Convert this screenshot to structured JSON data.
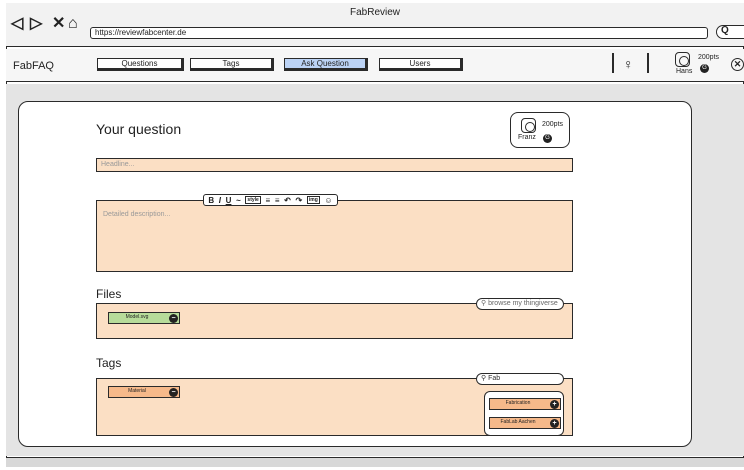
{
  "window": {
    "title": "FabReview",
    "url": "https://reviewfabcenter.de"
  },
  "browser_icons": {
    "back": "arrow-left-icon",
    "forward": "arrow-right-icon",
    "stop": "close-icon",
    "home": "home-icon",
    "search": "search-icon"
  },
  "app": {
    "brand": "FabFAQ",
    "tabs": [
      {
        "label": "Questions",
        "active": false
      },
      {
        "label": "Tags",
        "active": false
      },
      {
        "label": "Ask Question",
        "active": true
      },
      {
        "label": "Users",
        "active": false
      }
    ],
    "user": {
      "name": "Hans",
      "points": "200pts",
      "badge": "G"
    },
    "icons": {
      "notifications": "lightbulb-icon",
      "logout": "close-circle-icon"
    }
  },
  "form": {
    "heading": "Your question",
    "author": {
      "name": "Franz",
      "points": "200pts",
      "badge": "G"
    },
    "headline_placeholder": "Headline...",
    "description_placeholder": "Detailed description...",
    "toolbar": [
      "B",
      "I",
      "U",
      "~",
      "style",
      "≡",
      "≡",
      "↶",
      "↷",
      "img",
      "☺"
    ],
    "files": {
      "title": "Files",
      "search_placeholder": "browse my thingiverse",
      "items": [
        {
          "label": "Model.svg",
          "action": "−"
        }
      ]
    },
    "tags": {
      "title": "Tags",
      "search_value": "Fab",
      "items": [
        {
          "label": "Material",
          "action": "−"
        }
      ],
      "suggestions": [
        {
          "label": "Fabrication",
          "action": "+"
        },
        {
          "label": "FabLab Aachen",
          "action": "+"
        }
      ]
    }
  },
  "colors": {
    "field_fill": "#fbdfc4",
    "chip_green": "#b7dc9a",
    "chip_orange": "#f6b98a",
    "active_tab": "#bcd3f5"
  }
}
